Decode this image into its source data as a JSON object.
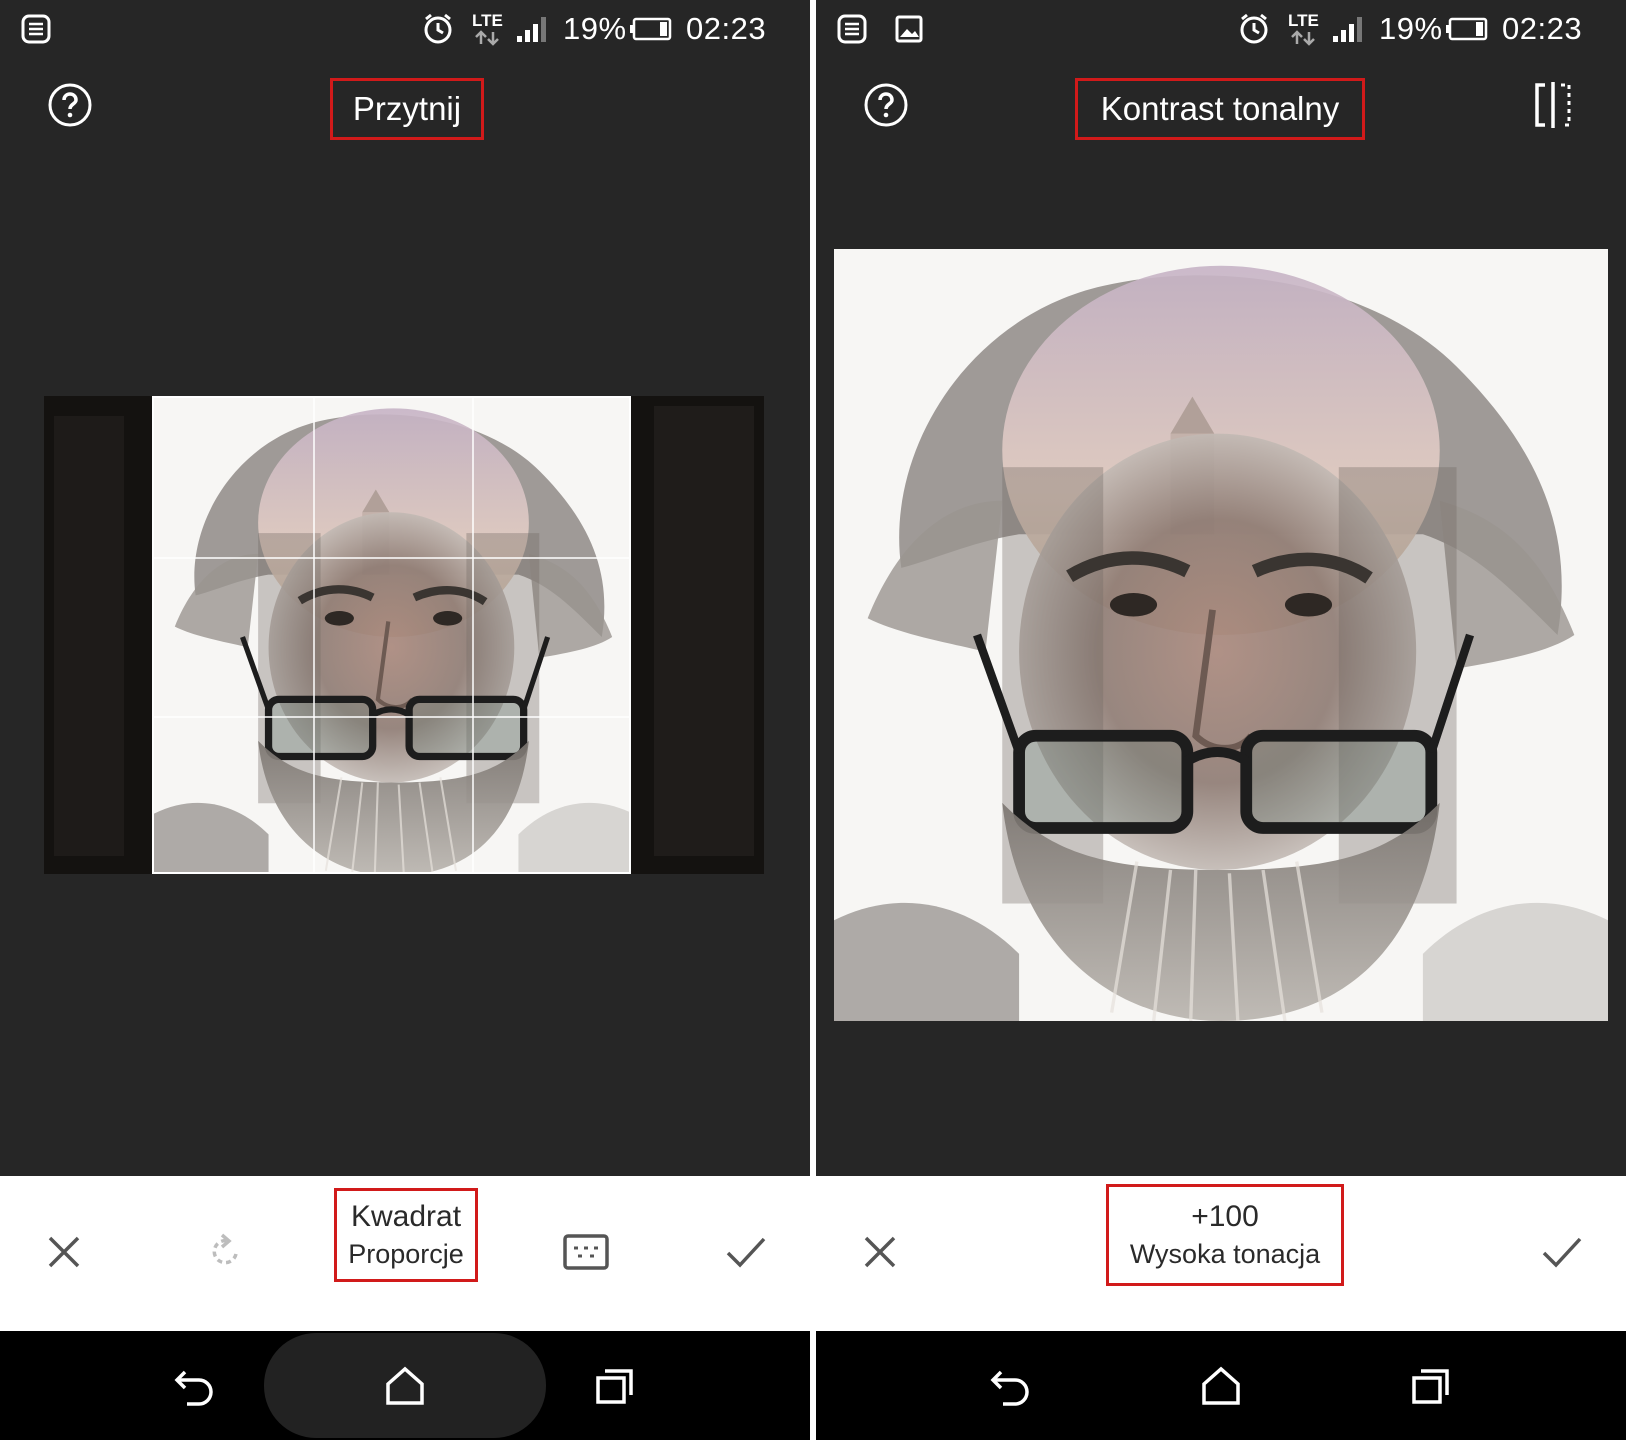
{
  "left_screen": {
    "status": {
      "network": "LTE",
      "battery": "19%",
      "time": "02:23"
    },
    "header": {
      "title": "Przytnij",
      "help_icon": "help-circle-icon"
    },
    "toolbar": {
      "cancel_icon": "close-icon",
      "rotate_icon": "rotate-icon",
      "aspect_value": "Kwadrat",
      "aspect_label": "Proporcje",
      "aspect_icon": "aspect-ratio-icon",
      "apply_icon": "check-icon"
    }
  },
  "right_screen": {
    "status": {
      "network": "LTE",
      "battery": "19%",
      "time": "02:23"
    },
    "header": {
      "title": "Kontrast tonalny",
      "help_icon": "help-circle-icon",
      "compare_icon": "compare-icon"
    },
    "toolbar": {
      "cancel_icon": "close-icon",
      "value": "+100",
      "label": "Wysoka tonacja",
      "apply_icon": "check-icon"
    }
  },
  "nav": {
    "back_icon": "back-icon",
    "home_icon": "home-icon",
    "recents_icon": "recents-icon"
  }
}
